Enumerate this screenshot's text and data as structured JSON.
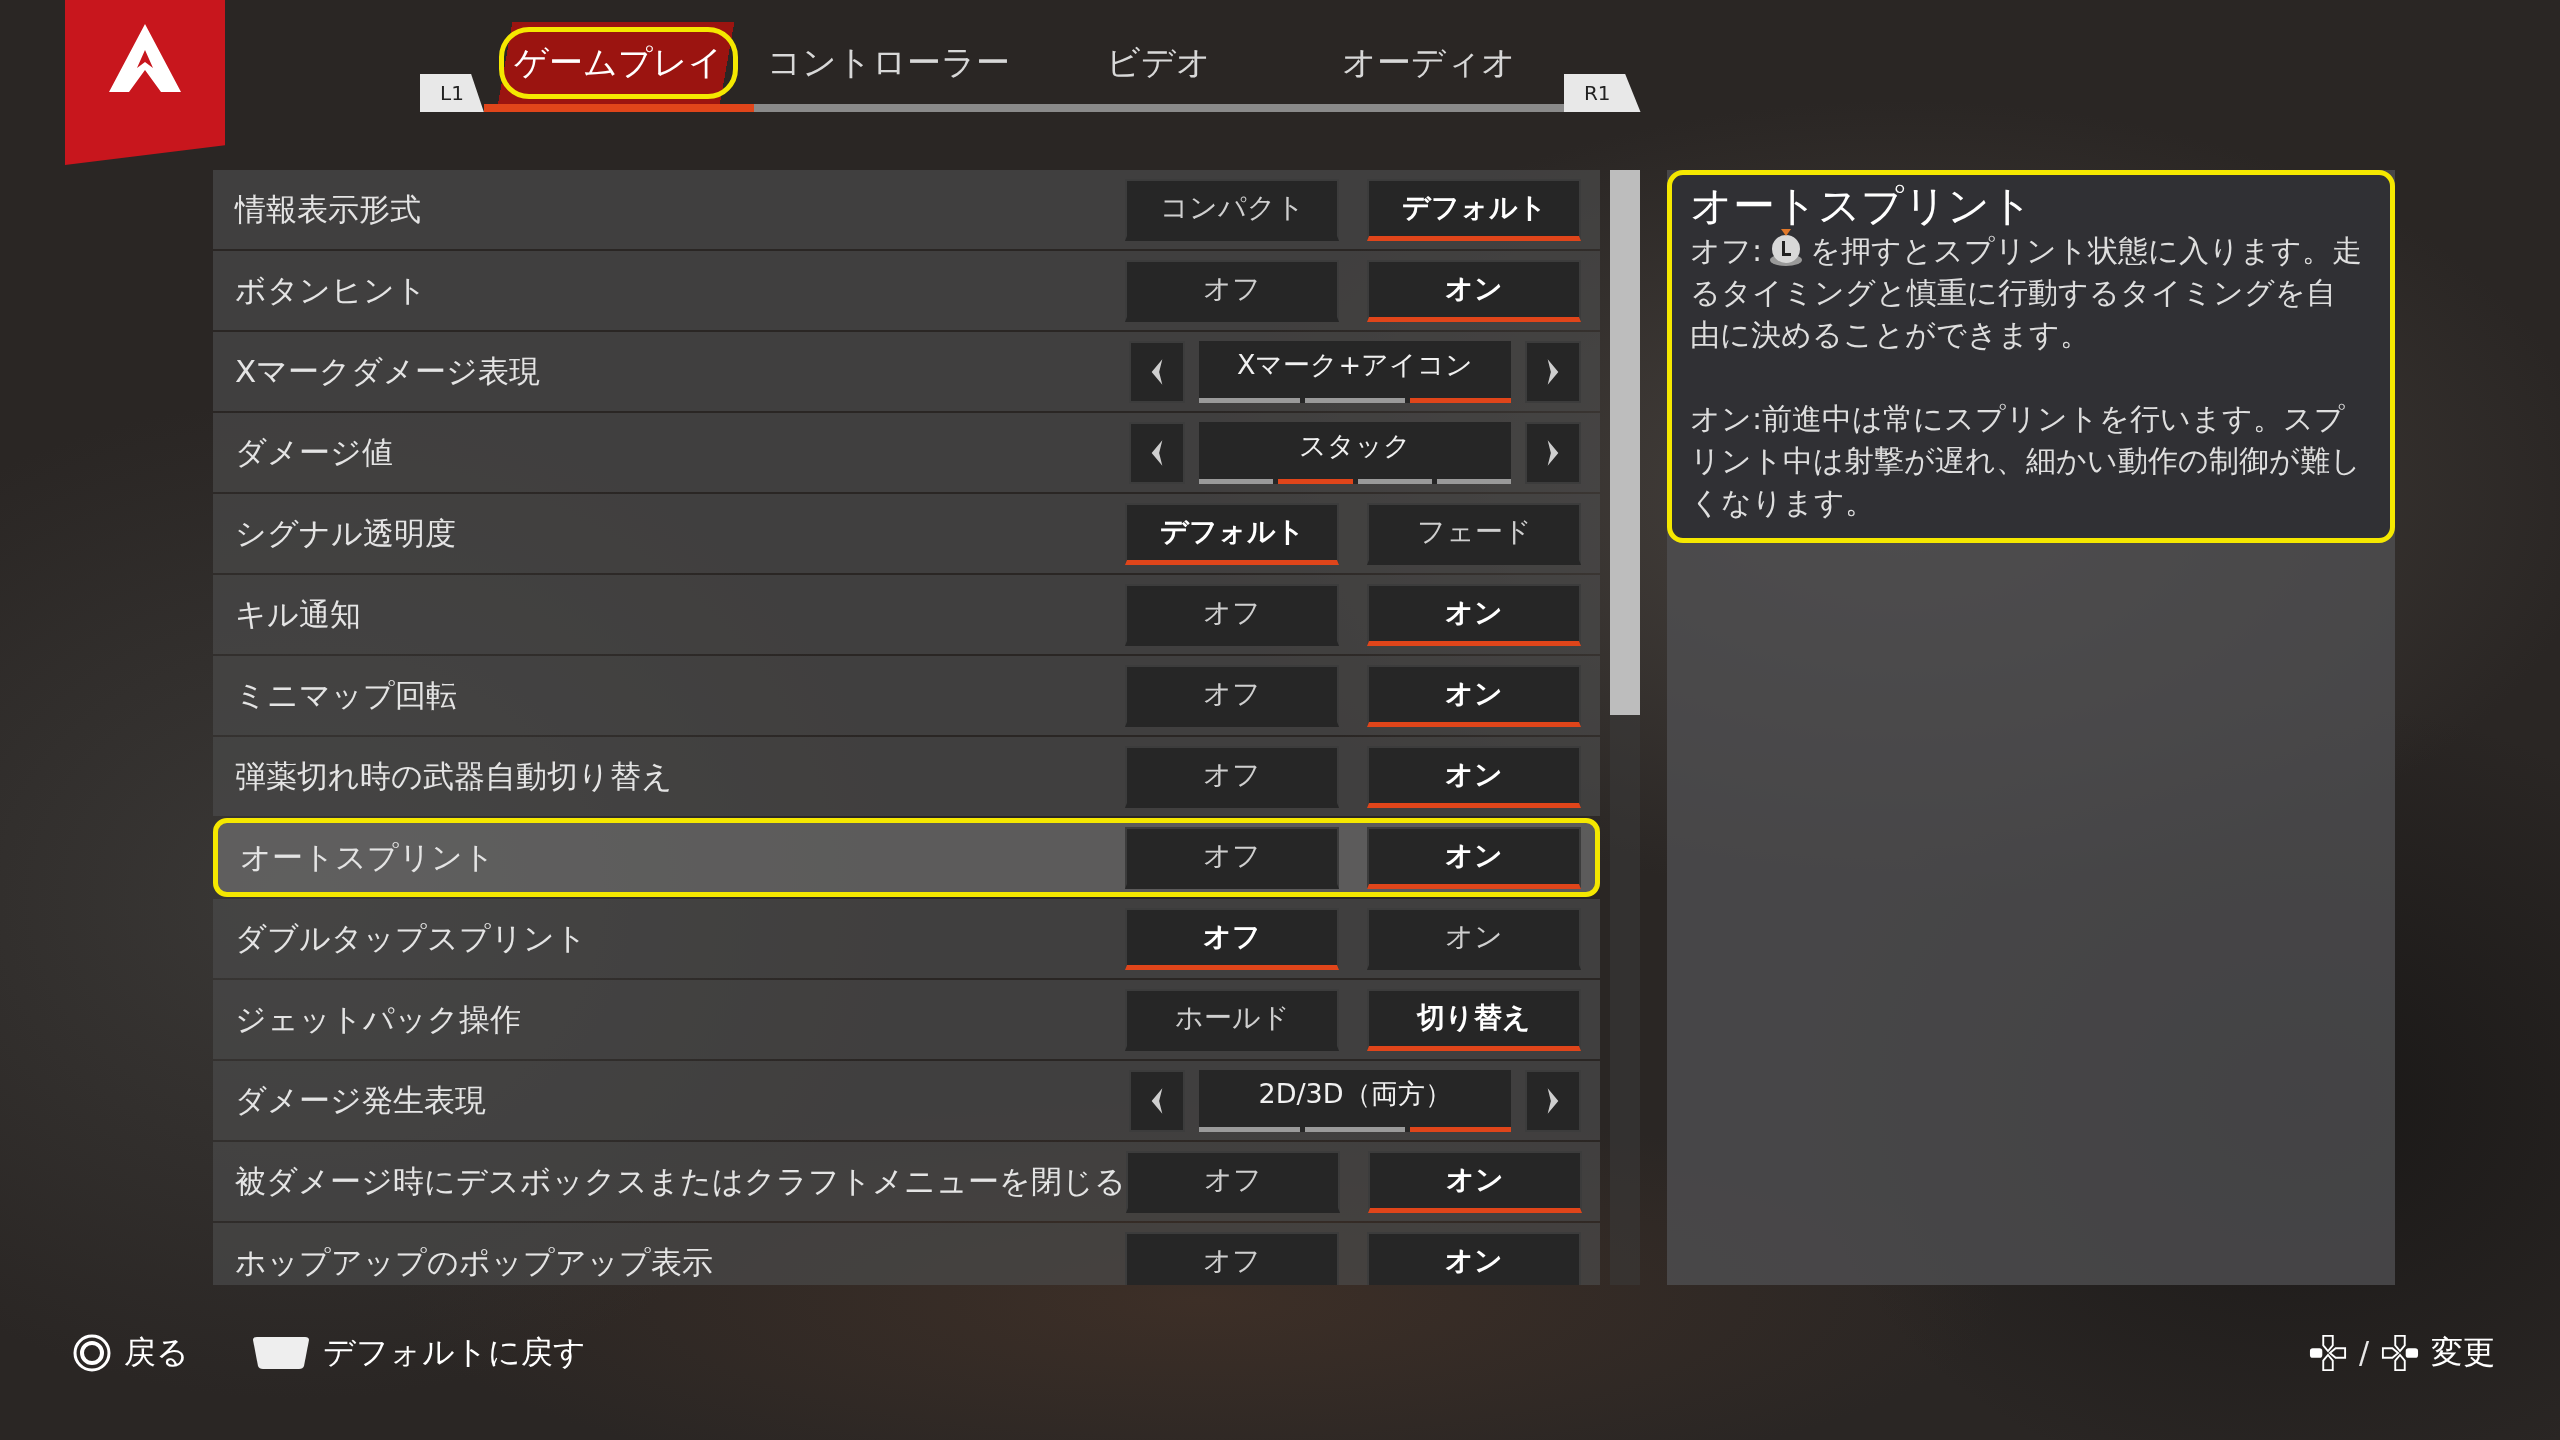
{
  "shoulders": {
    "left": "L1",
    "right": "R1"
  },
  "tabs": [
    {
      "label": "ゲームプレイ",
      "selected": true,
      "highlighted": true
    },
    {
      "label": "コントローラー",
      "selected": false,
      "highlighted": false
    },
    {
      "label": "ビデオ",
      "selected": false,
      "highlighted": false
    },
    {
      "label": "オーディオ",
      "selected": false,
      "highlighted": false
    }
  ],
  "settings": [
    {
      "label": "情報表示形式",
      "kind": "toggle",
      "highlighted": false,
      "options": [
        {
          "label": "コンパクト",
          "selected": false
        },
        {
          "label": "デフォルト",
          "selected": true
        }
      ]
    },
    {
      "label": "ボタンヒント",
      "kind": "toggle",
      "highlighted": false,
      "options": [
        {
          "label": "オフ",
          "selected": false
        },
        {
          "label": "オン",
          "selected": true
        }
      ]
    },
    {
      "label": "Xマークダメージ表現",
      "kind": "carousel",
      "highlighted": false,
      "value": "Xマーク+アイコン",
      "segments": [
        {
          "selected": false
        },
        {
          "selected": false
        },
        {
          "selected": true
        }
      ]
    },
    {
      "label": "ダメージ値",
      "kind": "carousel",
      "highlighted": false,
      "value": "スタック",
      "segments": [
        {
          "selected": false
        },
        {
          "selected": true
        },
        {
          "selected": false
        },
        {
          "selected": false
        }
      ]
    },
    {
      "label": "シグナル透明度",
      "kind": "toggle",
      "highlighted": false,
      "options": [
        {
          "label": "デフォルト",
          "selected": true
        },
        {
          "label": "フェード",
          "selected": false
        }
      ]
    },
    {
      "label": "キル通知",
      "kind": "toggle",
      "highlighted": false,
      "options": [
        {
          "label": "オフ",
          "selected": false
        },
        {
          "label": "オン",
          "selected": true
        }
      ]
    },
    {
      "label": "ミニマップ回転",
      "kind": "toggle",
      "highlighted": false,
      "options": [
        {
          "label": "オフ",
          "selected": false
        },
        {
          "label": "オン",
          "selected": true
        }
      ]
    },
    {
      "label": "弾薬切れ時の武器自動切り替え",
      "kind": "toggle",
      "highlighted": false,
      "options": [
        {
          "label": "オフ",
          "selected": false
        },
        {
          "label": "オン",
          "selected": true
        }
      ]
    },
    {
      "label": "オートスプリント",
      "kind": "toggle",
      "highlighted": true,
      "options": [
        {
          "label": "オフ",
          "selected": false
        },
        {
          "label": "オン",
          "selected": true
        }
      ]
    },
    {
      "label": "ダブルタップスプリント",
      "kind": "toggle",
      "highlighted": false,
      "options": [
        {
          "label": "オフ",
          "selected": true
        },
        {
          "label": "オン",
          "selected": false
        }
      ]
    },
    {
      "label": "ジェットパック操作",
      "kind": "toggle",
      "highlighted": false,
      "options": [
        {
          "label": "ホールド",
          "selected": false
        },
        {
          "label": "切り替え",
          "selected": true
        }
      ]
    },
    {
      "label": "ダメージ発生表現",
      "kind": "carousel",
      "highlighted": false,
      "value": "2D/3D（両方）",
      "segments": [
        {
          "selected": false
        },
        {
          "selected": false
        },
        {
          "selected": true
        }
      ]
    },
    {
      "label": "被ダメージ時にデスボックスまたはクラフトメニューを閉じる",
      "kind": "toggle",
      "highlighted": false,
      "options": [
        {
          "label": "オフ",
          "selected": false
        },
        {
          "label": "オン",
          "selected": true
        }
      ]
    },
    {
      "label": "ホップアップのポップアップ表示",
      "kind": "toggle",
      "highlighted": false,
      "options": [
        {
          "label": "オフ",
          "selected": false
        },
        {
          "label": "オン",
          "selected": true
        }
      ]
    }
  ],
  "description": {
    "highlighted": true,
    "title": "オートスプリント",
    "off_prefix": "オフ:",
    "off_text": "を押すとスプリント状態に入ります。走るタイミングと慎重に行動するタイミングを自由に決めることができます。",
    "on_text": "オン:前進中は常にスプリントを行います。スプリント中は射撃が遅れ、細かい動作の制御が難しくなります。"
  },
  "footer": {
    "back": "戻る",
    "reset": "デフォルトに戻す",
    "separator": "/",
    "change": "変更"
  }
}
